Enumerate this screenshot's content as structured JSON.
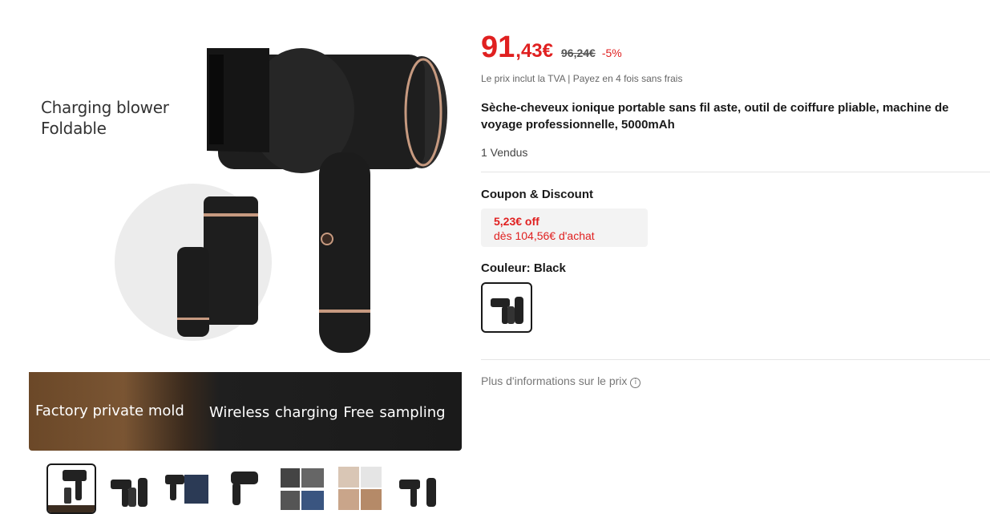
{
  "gallery": {
    "main_image": {
      "overlay_line1": "Charging blower",
      "overlay_line2": "Foldable",
      "banner_left": "Factory private mold",
      "banner_right": "Wireless charging  Free sampling"
    },
    "thumbnails": [
      {
        "icon": "hair-dryer-product-image",
        "active": true
      },
      {
        "icon": "hair-dryer-folding-image",
        "active": false
      },
      {
        "icon": "hair-dryer-charging-image",
        "active": false
      },
      {
        "icon": "hair-dryer-side-image",
        "active": false
      },
      {
        "icon": "hair-dryer-details-image",
        "active": false
      },
      {
        "icon": "hair-dryer-lifestyle-image",
        "active": false
      },
      {
        "icon": "hair-dryer-folded-image",
        "active": false
      }
    ]
  },
  "price": {
    "integer": "91",
    "decimal": ",43€",
    "original": "96,24€",
    "discount": "-5%",
    "tax_note": "Le prix inclut la TVA | Payez en 4 fois sans frais"
  },
  "product": {
    "title": "Sèche-cheveux ionique portable sans fil aste, outil de coiffure pliable, machine de voyage professionnelle, 5000mAh",
    "sold": "1 Vendus"
  },
  "coupon": {
    "heading": "Coupon & Discount",
    "amount": "5,23€ off",
    "condition": "dès 104,56€ d'achat"
  },
  "color": {
    "heading": "Couleur: Black",
    "selected": "Black"
  },
  "more_info": {
    "label": "Plus d'informations sur le prix",
    "icon": "info-icon"
  },
  "colors": {
    "price_red": "#e02020",
    "text": "#191919"
  }
}
